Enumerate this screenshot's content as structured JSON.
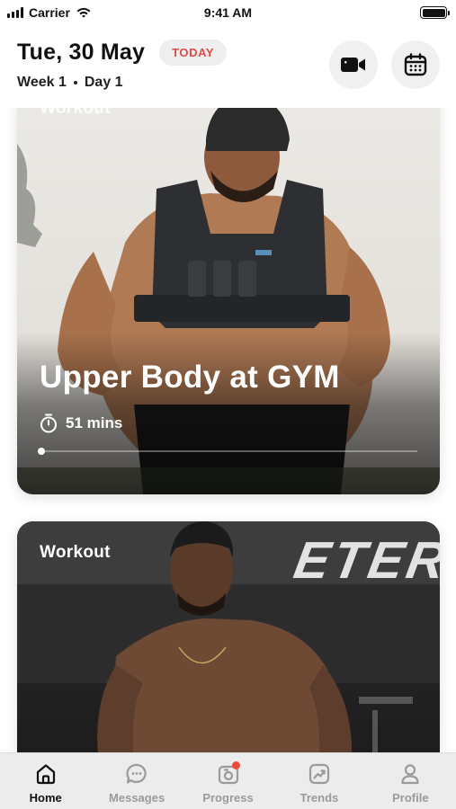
{
  "status_bar": {
    "carrier": "Carrier",
    "time": "9:41 AM"
  },
  "header": {
    "date": "Tue, 30 May",
    "today_badge": "TODAY",
    "week": "Week 1",
    "day": "Day 1",
    "actions": [
      {
        "icon": "video-camera-icon"
      },
      {
        "icon": "calendar-icon"
      }
    ]
  },
  "cards": [
    {
      "label": "Workout",
      "title": "Upper Body at GYM",
      "duration": "51 mins",
      "progress_fraction": 0.0
    },
    {
      "label": "Workout",
      "signage": "ETER"
    }
  ],
  "tabs": [
    {
      "label": "Home",
      "icon": "home-icon",
      "active": true
    },
    {
      "label": "Messages",
      "icon": "chat-bubble-icon",
      "active": false
    },
    {
      "label": "Progress",
      "icon": "progress-camera-icon",
      "active": false,
      "badge": true
    },
    {
      "label": "Trends",
      "icon": "trend-chart-icon",
      "active": false
    },
    {
      "label": "Profile",
      "icon": "user-icon",
      "active": false
    }
  ],
  "colors": {
    "accent_red": "#e04848",
    "badge_red": "#ef4b3d",
    "tab_active": "#111111",
    "tab_inactive": "#9a9a9a"
  }
}
